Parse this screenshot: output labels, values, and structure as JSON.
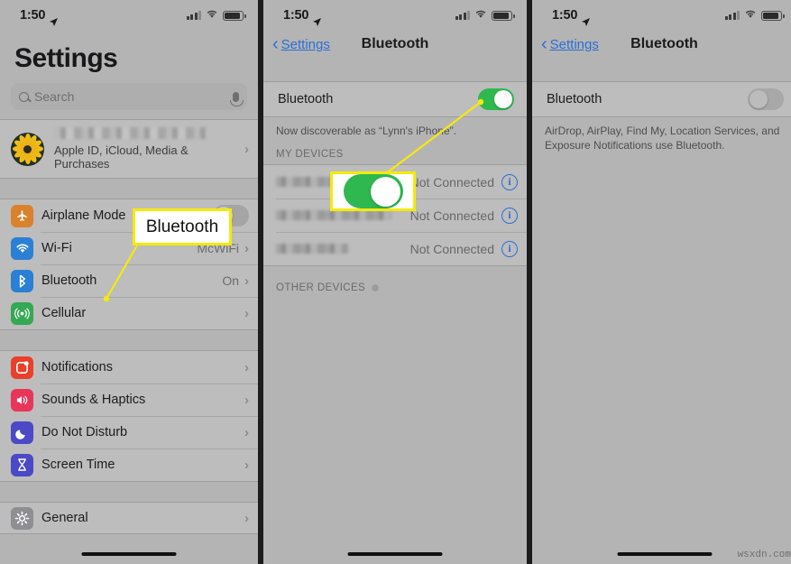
{
  "watermark": "wsxdn.com",
  "statusbar": {
    "time": "1:50",
    "location_icon": "location-arrow-icon",
    "signal_icon": "cellular-bars-icon",
    "wifi_icon": "wifi-icon",
    "battery_icon": "battery-icon"
  },
  "panel1": {
    "title": "Settings",
    "search": {
      "placeholder": "Search",
      "icon": "search-icon",
      "mic_icon": "microphone-icon"
    },
    "account": {
      "name_blurred": "",
      "subtitle": "Apple ID, iCloud, Media & Purchases",
      "avatar_icon": "sunflower-avatar"
    },
    "group1": [
      {
        "label": "Airplane Mode",
        "icon": "airplane-icon",
        "color": "#d9822b",
        "control": "toggle-off",
        "value": ""
      },
      {
        "label": "Wi-Fi",
        "icon": "wifi-icon",
        "color": "#2b7fd4",
        "control": "chevron",
        "value": "McWiFi"
      },
      {
        "label": "Bluetooth",
        "icon": "bluetooth-icon",
        "color": "#2b7fd4",
        "control": "chevron",
        "value": "On"
      },
      {
        "label": "Cellular",
        "icon": "cellular-icon",
        "color": "#35a853",
        "control": "chevron",
        "value": ""
      }
    ],
    "group2": [
      {
        "label": "Notifications",
        "icon": "notifications-icon",
        "color": "#e8402a",
        "control": "chevron",
        "value": ""
      },
      {
        "label": "Sounds & Haptics",
        "icon": "sounds-icon",
        "color": "#e8355a",
        "control": "chevron",
        "value": ""
      },
      {
        "label": "Do Not Disturb",
        "icon": "moon-icon",
        "color": "#4b49c6",
        "control": "chevron",
        "value": ""
      },
      {
        "label": "Screen Time",
        "icon": "hourglass-icon",
        "color": "#4b49c6",
        "control": "chevron",
        "value": ""
      }
    ],
    "group3": [
      {
        "label": "General",
        "icon": "gear-icon",
        "color": "#8e8e93",
        "control": "chevron",
        "value": ""
      }
    ],
    "callout": {
      "label": "Bluetooth"
    }
  },
  "panel2": {
    "nav": {
      "back_label": "Settings",
      "title": "Bluetooth",
      "back_icon": "chevron-left-icon"
    },
    "bluetooth_row": {
      "label": "Bluetooth",
      "toggle_state": "on"
    },
    "discoverable_note": "Now discoverable as “Lynn's iPhone”.",
    "my_devices_header": "MY DEVICES",
    "devices": [
      {
        "name_blurred": "",
        "status": "Not Connected",
        "info_icon": "info-circle-icon",
        "name_width": 78
      },
      {
        "name_blurred": "",
        "status": "Not Connected",
        "info_icon": "info-circle-icon",
        "name_width": 128
      },
      {
        "name_blurred": "",
        "status": "Not Connected",
        "info_icon": "info-circle-icon",
        "name_width": 80
      }
    ],
    "other_devices_header": "OTHER DEVICES",
    "spinner_icon": "loading-spinner-icon",
    "callout_toggle_state": "on"
  },
  "panel3": {
    "nav": {
      "back_label": "Settings",
      "title": "Bluetooth",
      "back_icon": "chevron-left-icon"
    },
    "bluetooth_row": {
      "label": "Bluetooth",
      "toggle_state": "off"
    },
    "footnote": "AirDrop, AirPlay, Find My, Location Services, and Exposure Notifications use Bluetooth."
  },
  "colors": {
    "accent_blue": "#2b6fd6",
    "toggle_green": "#2eb84f",
    "callout_yellow": "#f5ea0a"
  }
}
